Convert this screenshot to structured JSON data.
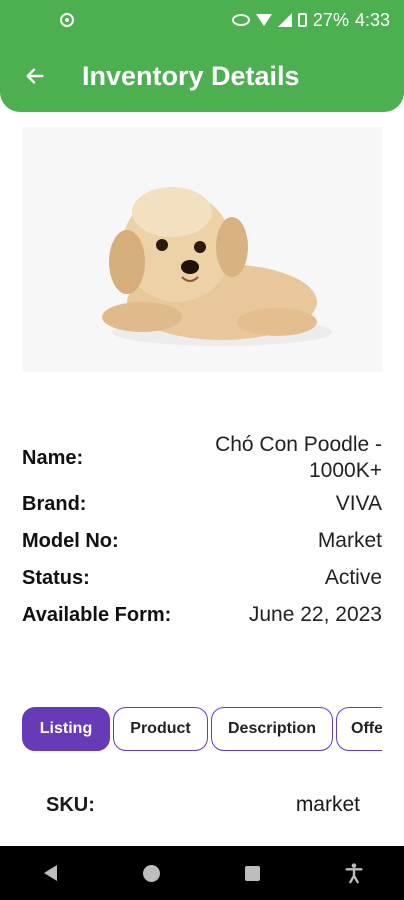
{
  "status_bar": {
    "battery": "27%",
    "time": "4:33",
    "icons": [
      "location-icon",
      "eye-icon",
      "wifi-icon",
      "signal-icon",
      "battery-icon"
    ]
  },
  "app_bar": {
    "title": "Inventory Details",
    "back_icon": "back-arrow-icon",
    "color": "#4caf50"
  },
  "details": {
    "name_label": "Name:",
    "name_value": "Chó Con Poodle - 1000K+",
    "brand_label": "Brand:",
    "brand_value": "VIVA",
    "model_label": "Model No:",
    "model_value": "Market",
    "status_label": "Status:",
    "status_value": "Active",
    "available_label": "Available Form:",
    "available_value": "June 22, 2023"
  },
  "tabs": {
    "active_color": "#673ab7",
    "items": [
      {
        "label": "Listing",
        "active": true
      },
      {
        "label": "Product",
        "active": false
      },
      {
        "label": "Description",
        "active": false
      },
      {
        "label": "Offe",
        "active": false
      }
    ]
  },
  "sku": {
    "label": "SKU:",
    "value": "market"
  },
  "nav_bar": {
    "icons": [
      "back-triangle-icon",
      "home-circle-icon",
      "recents-square-icon",
      "accessibility-icon"
    ]
  }
}
